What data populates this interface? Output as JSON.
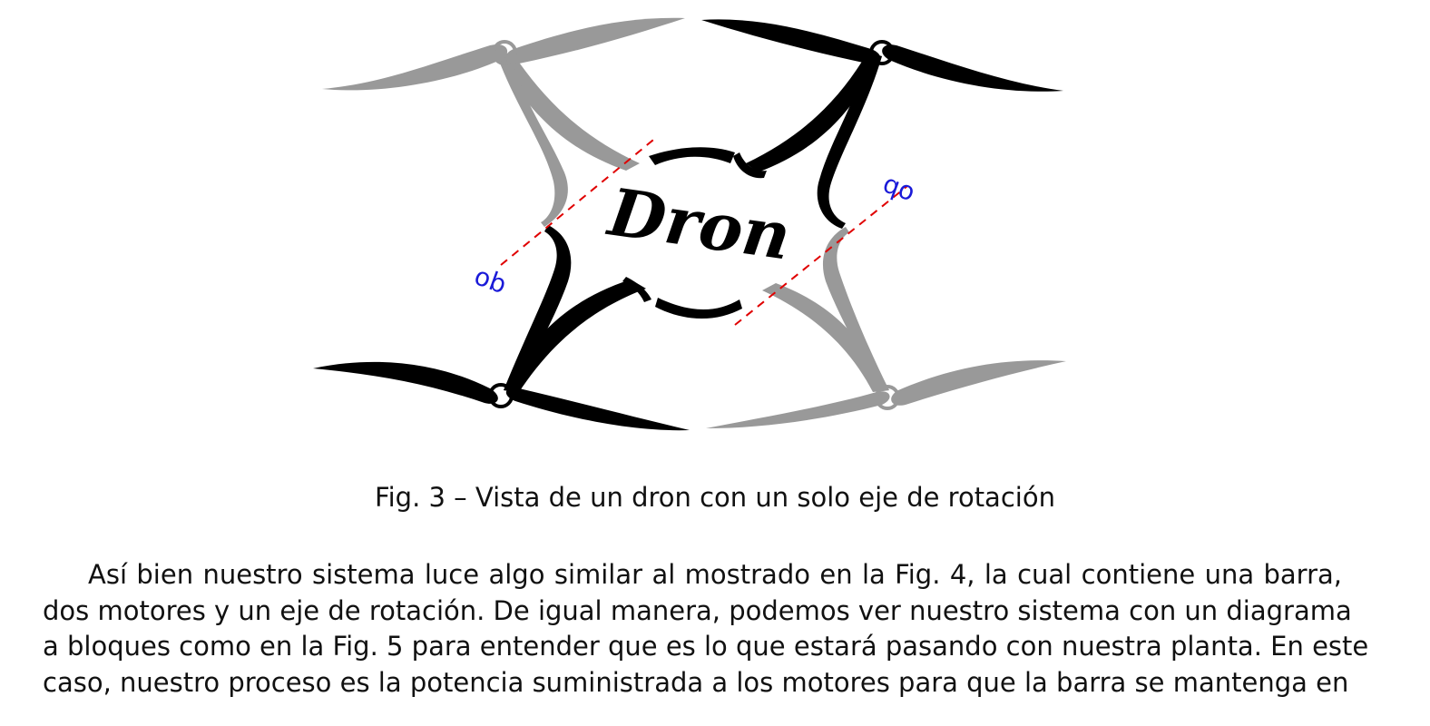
{
  "figure": {
    "drone_label": "Dron",
    "axis_marker_left": "ob",
    "axis_marker_right": "qo",
    "colors": {
      "dark_propeller": "#000000",
      "light_propeller": "#999999",
      "axis_line": "#e00000",
      "axis_marker": "#1a1ad8"
    }
  },
  "caption": "Fig. 3 – Vista de un dron con un solo eje de rotación",
  "paragraph": {
    "lines": [
      "Así bien nuestro sistema luce algo similar al mostrado en la Fig. 4, la cual contiene una barra,",
      "dos motores y un eje de rotación. De igual manera, podemos ver nuestro sistema con un diagrama",
      "a bloques como en la Fig. 5 para entender que es lo que estará pasando con nuestra planta. En este",
      "caso, nuestro proceso es la potencia suministrada a los motores para que la barra se mantenga en"
    ]
  }
}
